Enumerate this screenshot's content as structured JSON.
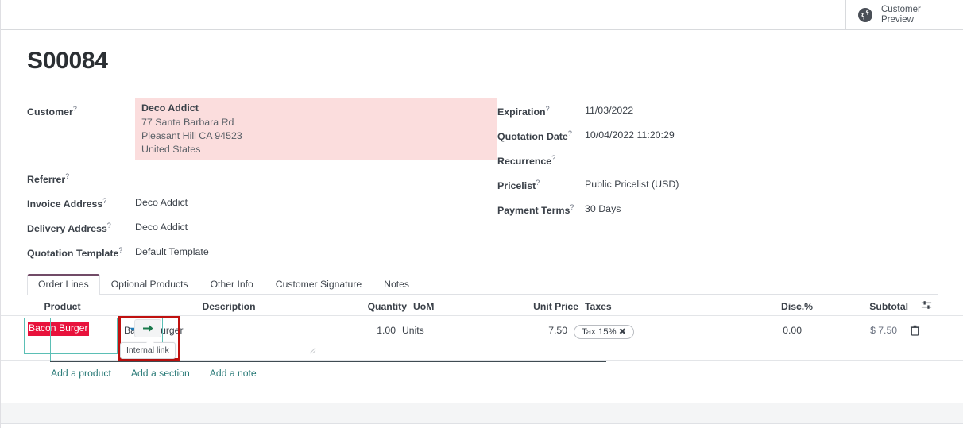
{
  "statbar": {
    "customer_preview_label": "Customer\nPreview",
    "globe_icon": "globe-icon"
  },
  "record": {
    "title": "S00084"
  },
  "form": {
    "left": [
      {
        "label": "Customer",
        "help": "?",
        "value": ""
      },
      {
        "label": "Referrer",
        "help": "?",
        "value": ""
      },
      {
        "label": "Invoice Address",
        "help": "?",
        "value": "Deco Addict"
      },
      {
        "label": "Delivery Address",
        "help": "?",
        "value": "Deco Addict"
      },
      {
        "label": "Quotation Template",
        "help": "?",
        "value": "Default Template"
      }
    ],
    "customer": {
      "name": "Deco Addict",
      "street": "77 Santa Barbara Rd",
      "city": "Pleasant Hill CA 94523",
      "country": "United States"
    },
    "right": [
      {
        "label": "Expiration",
        "help": "?",
        "value": "11/03/2022"
      },
      {
        "label": "Quotation Date",
        "help": "?",
        "value": "10/04/2022 11:20:29"
      },
      {
        "label": "Recurrence",
        "help": "?",
        "value": ""
      },
      {
        "label": "Pricelist",
        "help": "?",
        "value": "Public Pricelist (USD)"
      },
      {
        "label": "Payment Terms",
        "help": "?",
        "value": "30 Days"
      }
    ]
  },
  "notebook": {
    "tabs": [
      {
        "label": "Order Lines",
        "active": true
      },
      {
        "label": "Optional Products",
        "active": false
      },
      {
        "label": "Other Info",
        "active": false
      },
      {
        "label": "Customer Signature",
        "active": false
      },
      {
        "label": "Notes",
        "active": false
      }
    ]
  },
  "lines": {
    "headers": {
      "product": "Product",
      "description": "Description",
      "quantity": "Quantity",
      "uom": "UoM",
      "unit_price": "Unit Price",
      "taxes": "Taxes",
      "discount": "Disc.%",
      "subtotal": "Subtotal",
      "options_icon": "sliders-icon"
    },
    "row": {
      "product": "Bacon Burger",
      "description": "Bacon Burger",
      "quantity": "1.00",
      "uom": "Units",
      "unit_price": "7.50",
      "tax_tag": "Tax 15%",
      "tax_remove": "✖",
      "discount": "0.00",
      "subtotal": "$ 7.50",
      "delete_icon": "trash-icon",
      "dropdown_icon": "chevron-down-icon",
      "internal_link_icon": "arrow-right-icon"
    },
    "tooltip": "Internal link",
    "add_links": [
      {
        "label": "Add a product"
      },
      {
        "label": "Add a section"
      },
      {
        "label": "Add a note"
      }
    ]
  },
  "colors": {
    "accent_purple": "#714b67",
    "link_teal": "#297a77",
    "invalid_bg": "#fbdddd",
    "selection_red": "#e8123c",
    "annotation_red": "#c0110f",
    "focus_teal": "#5bbfb5"
  }
}
